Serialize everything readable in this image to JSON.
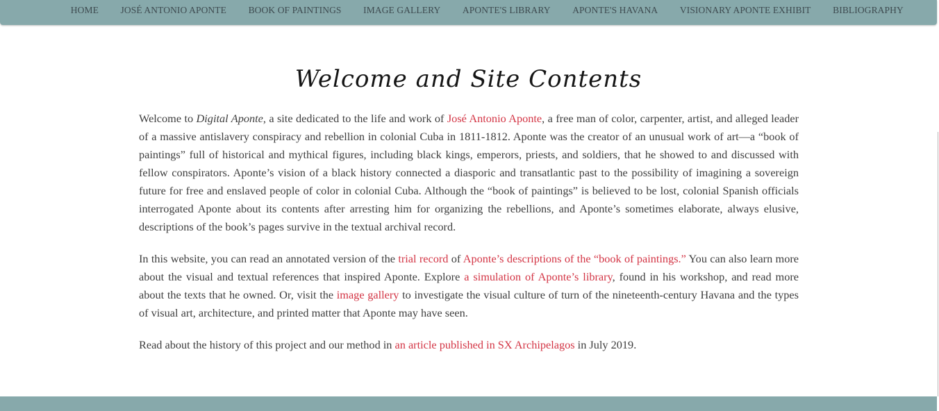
{
  "nav": {
    "items": [
      {
        "label": "HOME"
      },
      {
        "label": "JOSÉ ANTONIO APONTE"
      },
      {
        "label": "BOOK OF PAINTINGS"
      },
      {
        "label": "IMAGE GALLERY"
      },
      {
        "label": "APONTE'S LIBRARY"
      },
      {
        "label": "APONTE'S HAVANA"
      },
      {
        "label": "VISIONARY APONTE EXHIBIT"
      },
      {
        "label": "BIBLIOGRAPHY"
      }
    ]
  },
  "page": {
    "title": "Welcome and Site Contents"
  },
  "intro": {
    "p1_a": "Welcome to ",
    "site_name": "Digital Aponte",
    "p1_b": ", a site dedicated to the life and work of ",
    "link_aponte": "José Antonio Aponte",
    "p1_c": ", a free man of color, carpenter, artist, and alleged leader of a massive antislavery conspiracy and rebellion in colonial Cuba in 1811-1812. Aponte was the creator of an unusual work of art—a “book of paintings” full of historical and mythical figures, including black kings, emperors, priests, and soldiers, that he showed to and discussed with fellow conspirators. Aponte’s vision of a black history connected a diasporic and transatlantic past to the possibility of imagining a sovereign future for free and enslaved people of color in colonial Cuba. Although the “book of paintings” is believed to be lost, colonial Spanish officials interrogated Aponte about its contents after arresting him for organizing the rebellions, and Aponte’s sometimes elaborate, always elusive, descriptions of the book’s pages survive in the textual archival record."
  },
  "explore": {
    "p2_a": "In this website, you can read an annotated version of the ",
    "link_trial": "trial record",
    "p2_b": " of ",
    "link_descriptions": "Aponte’s descriptions of the “book of paintings.”",
    "p2_c": " You can also learn more about the visual and textual references that inspired Aponte. Explore ",
    "link_library": "a simulation of Aponte’s library",
    "p2_d": ", found in his workshop, and read more about the texts that he owned. Or, visit the ",
    "link_gallery": "image gallery",
    "p2_e": " to investigate the visual culture of turn of the nineteenth-century Havana and the types of visual art, architecture, and printed matter that Aponte may have seen."
  },
  "history": {
    "p3_a": "Read about the history of this project and our method in ",
    "link_article": "an article published in SX Archipelagos",
    "p3_b": " in July 2019."
  },
  "colors": {
    "nav_bg": "#87a9ab",
    "link": "#d33444",
    "text": "#3d3d3d"
  }
}
